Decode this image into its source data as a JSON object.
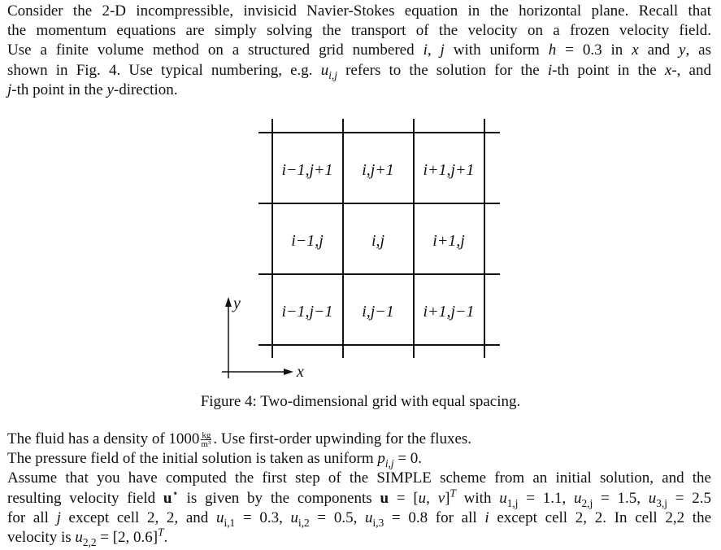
{
  "intro": {
    "lines": [
      "Consider the 2-D incompressible, invisicid Navier-Stokes equation in the horizontal plane. Recall that",
      "the momentum equations are simply solving the transport of the velocity on a frozen velocity field.",
      "Use a finite volume method on a structured grid numbered",
      "shown in Fig. 4. Use typical numbering, e.g.",
      "-th point in the"
    ],
    "line3_mid": "with uniform",
    "line3_h": "h",
    "line3_eq": " = 0.3 in ",
    "line3_x": "x",
    "line3_and": " and ",
    "line3_y": "y",
    "line3_end": ", as",
    "line3_ij": "i, j",
    "line4_u": "u",
    "line4_sub": "i,j",
    "line4_mid": " refers to the solution for the ",
    "line4_i": "i",
    "line4_th": "-th point in the ",
    "line4_x": "x",
    "line4_end": "-, and",
    "line5_j": "j",
    "line5_y": "y",
    "line5_end": "-direction."
  },
  "figure": {
    "cells": [
      [
        "i−1,j+1",
        "i,j+1",
        "i+1,j+1"
      ],
      [
        "i−1,j",
        "i,j",
        "i+1,j"
      ],
      [
        "i−1,j−1",
        "i,j−1",
        "i+1,j−1"
      ]
    ],
    "axis_x": "x",
    "axis_y": "y",
    "caption": "Figure 4: Two-dimensional grid with equal spacing."
  },
  "body": {
    "density_pre": "The fluid has a density of 1000",
    "density_num": "kg",
    "density_den": "m³",
    "density_post": ". Use first-order upwinding for the fluxes.",
    "pressure_pre": "The pressure field of the initial solution is taken as uniform ",
    "pressure_p": "p",
    "pressure_sub": "i,j",
    "pressure_post": " = 0.",
    "simple_line": "Assume that you have computed the first step of the SIMPLE scheme from an initial solution, and the",
    "vel_pre": "resulting velocity field ",
    "vel_u": "u",
    "vel_star": "⋆",
    "vel_mid": " is given by the components ",
    "vel_u2": "u",
    "vel_eq": " = [",
    "vel_uv": "u, v",
    "vel_T": "T",
    "vel_with": " with ",
    "u1": "u",
    "u1_sub": "1,j",
    "u1_val": " = 1.1, ",
    "u2": "u",
    "u2_sub": "2,j",
    "u2_val": " = 1.5, ",
    "u3": "u",
    "u3_sub": "3,j",
    "u3_val": " = 2.5",
    "forall_pre": "for all ",
    "forall_j": "j",
    "forall_mid": " except cell 2, 2, and ",
    "ui1": "u",
    "ui1_sub": "i,1",
    "ui1_val": " = 0.3, ",
    "ui2": "u",
    "ui2_sub": "i,2",
    "ui2_val": " = 0.5, ",
    "ui3": "u",
    "ui3_sub": "i,3",
    "ui3_val": " = 0.8 for all ",
    "forall_i": "i",
    "forall_end": " except cell 2, 2. In cell 2,2 the",
    "last_pre": "velocity is ",
    "last_u": "u",
    "last_sub": "2,2",
    "last_val": " = [2, 0.6]",
    "last_T": "T",
    "last_end": "."
  }
}
